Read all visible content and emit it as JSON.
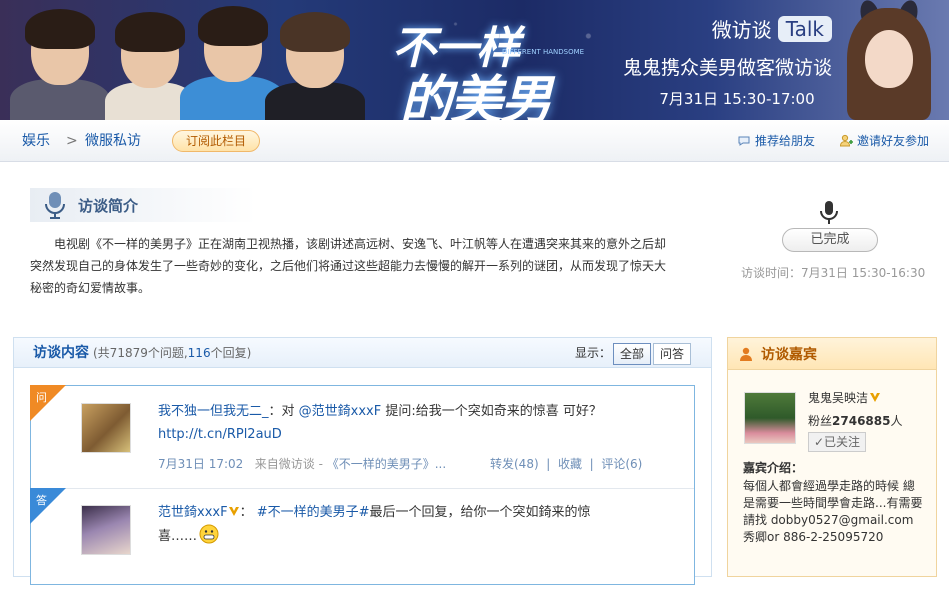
{
  "banner": {
    "title_line1": "不一样",
    "title_line2": "的美男子",
    "title_sub": "DIFFERENT HANDSOME",
    "talk_cn": "微访谈",
    "talk_en": "Talk",
    "host_line": "鬼鬼携众美男做客微访谈",
    "time_line": "7月31日  15:30-17:00"
  },
  "nav": {
    "crumb_1": "娱乐",
    "crumb_sep": ">",
    "crumb_2": "微服私访",
    "subscribe": "订阅此栏目",
    "recommend": "推荐给朋友",
    "invite": "邀请好友参加"
  },
  "intro": {
    "title": "访谈简介",
    "text": "电视剧《不一样的美男子》正在湖南卫视热播，该剧讲述高远树、安逸飞、叶江帆等人在遭遇突来其来的意外之后却突然发现自己的身体发生了一些奇妙的变化，之后他们将通过这些超能力去慢慢的解开一系列的谜团，从而发现了惊天大秘密的奇幻爱情故事。",
    "status": "已完成",
    "time": "访谈时间：7月31日  15:30-16:30"
  },
  "content": {
    "title": "访谈内容",
    "count_prefix": "(共71879个问题,",
    "count_answers": "116",
    "count_suffix": "个回复)",
    "display_label": "显示：",
    "tabs": [
      "全部",
      "问答"
    ],
    "items": [
      {
        "tag": "问",
        "user": "我不独一但我无二_",
        "mid": "：对 ",
        "mention": "@范世錡xxxF",
        "body": " 提问:给我一个突如奇来的惊喜 可好？ ",
        "link": "http://t.cn/RPl2auD",
        "time": "7月31日 17:02",
        "source_prefix": "来自微访谈 - ",
        "source": "《不一样的美男子》...",
        "forward": "转发(48)",
        "sep": "|",
        "favorite": "收藏",
        "comment": "评论(6)"
      },
      {
        "tag": "答",
        "user": "范世錡xxxF",
        "mid": "：  ",
        "topic": "#不一样的美男子#",
        "body": "最后一个回复，给你一个突如錡来的惊喜……"
      }
    ]
  },
  "guest": {
    "title": "访谈嘉宾",
    "name": "鬼鬼吴映洁",
    "fans_label": "粉丝",
    "fans_count": "2746885",
    "fans_unit": "人",
    "follow": "✓已关注",
    "intro_label": "嘉宾介绍：",
    "intro_text": "每個人都會經過學走路的時候 總是需要一些時間學會走路...有需要請找  dobby0527@gmail.com秀卿or 886-2-25095720"
  },
  "colors": {
    "link_blue": "#1a5aa8",
    "tag_orange": "#f08a24",
    "tag_blue": "#3a8ad8",
    "verified": "#e8a000"
  }
}
